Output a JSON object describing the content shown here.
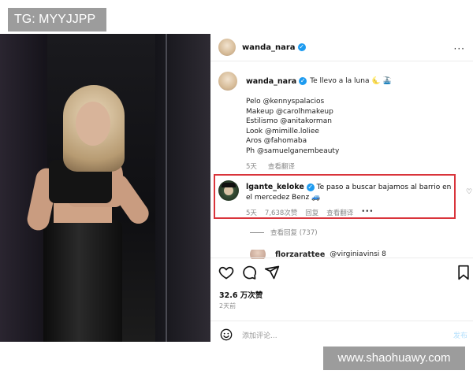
{
  "overlay_tag": "TG: MYYJJPP",
  "watermark": "www.shaohuawy.com",
  "post": {
    "username": "wanda_nara",
    "carousel_dots": 6,
    "carousel_active": 1
  },
  "caption": {
    "username": "wanda_nara",
    "text": "Te llevo a la luna",
    "emoji": "🌜 🚠",
    "lines": [
      "Pelo @kennyspalacios",
      "Makeup @carolhmakeup",
      "Estilismo @anitakorman",
      "Look @mimille.loliee",
      "Aros @fahomaba",
      "Ph @samuelganembeauty"
    ],
    "time": "5天",
    "translate": "查看翻译"
  },
  "comment": {
    "username": "lgante_keloke",
    "text": "Te paso a buscar bajamos al barrio en el mercedez Benz 🚙",
    "time": "5天",
    "likes": "7,638次赞",
    "reply": "回复",
    "translate": "查看翻译",
    "more": "•••",
    "view_replies": "查看回复 (737)"
  },
  "next_comment": {
    "username": "florzarattee",
    "text": "@virginiavinsi 8"
  },
  "stats": {
    "likes": "32.6 万次赞",
    "ago": "2天前"
  },
  "add_comment": {
    "placeholder": "添加评论...",
    "post_label": "发布"
  },
  "colors": {
    "highlight": "#d9343b",
    "verified": "#1d9bf0",
    "overlay": "#9c9c9c"
  }
}
